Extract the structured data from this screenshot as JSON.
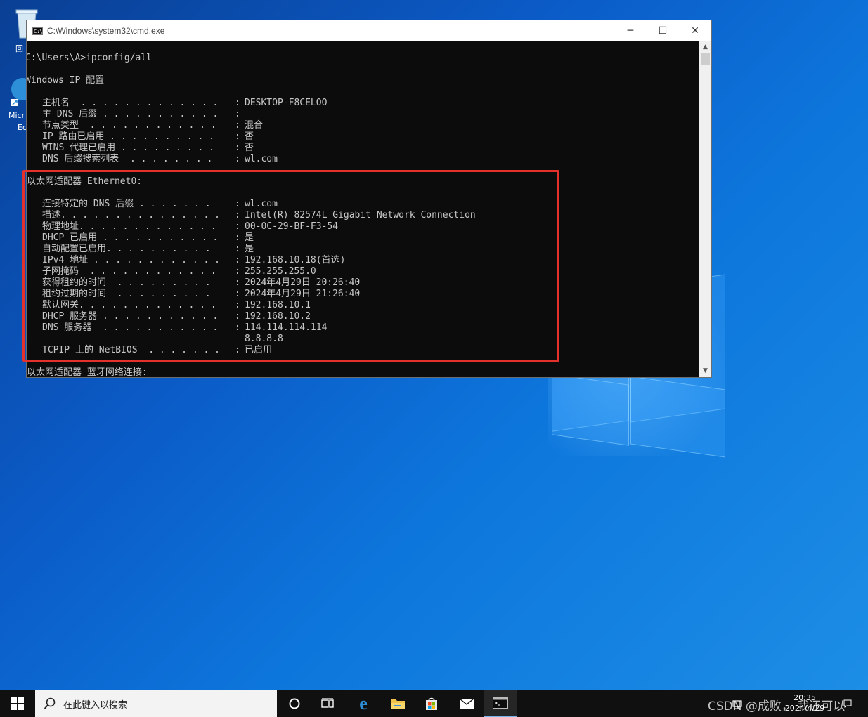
{
  "window": {
    "title": "C:\\Windows\\system32\\cmd.exe",
    "icon_label": "C:\\",
    "minimize_glyph": "─",
    "maximize_glyph": "☐",
    "close_glyph": "✕"
  },
  "console": {
    "command": "C:\\Users\\A>ipconfig/all",
    "header": "Windows IP 配置",
    "global_rows": [
      {
        "key": "主机名  . . . . . . . . . . . . .",
        "value": "DESKTOP-F8CELOO"
      },
      {
        "key": "主 DNS 后缀 . . . . . . . . . . .",
        "value": ""
      },
      {
        "key": "节点类型  . . . . . . . . . . . .",
        "value": "混合"
      },
      {
        "key": "IP 路由已启用 . . . . . . . . . .",
        "value": "否"
      },
      {
        "key": "WINS 代理已启用 . . . . . . . . .",
        "value": "否"
      },
      {
        "key": "DNS 后缀搜索列表  . . . . . . . .",
        "value": "wl.com"
      }
    ],
    "adapter_header": "以太网适配器 Ethernet0:",
    "adapter_rows": [
      {
        "key": "连接特定的 DNS 后缀 . . . . . . .",
        "value": "wl.com"
      },
      {
        "key": "描述. . . . . . . . . . . . . . .",
        "value": "Intel(R) 82574L Gigabit Network Connection"
      },
      {
        "key": "物理地址. . . . . . . . . . . . .",
        "value": "00-0C-29-BF-F3-54"
      },
      {
        "key": "DHCP 已启用 . . . . . . . . . . .",
        "value": "是"
      },
      {
        "key": "自动配置已启用. . . . . . . . . .",
        "value": "是"
      },
      {
        "key": "IPv4 地址 . . . . . . . . . . . .",
        "value": "192.168.10.18(首选)"
      },
      {
        "key": "子网掩码  . . . . . . . . . . . .",
        "value": "255.255.255.0"
      },
      {
        "key": "获得租约的时间  . . . . . . . . .",
        "value": "2024年4月29日 20:26:40"
      },
      {
        "key": "租约过期的时间  . . . . . . . . .",
        "value": "2024年4月29日 21:26:40"
      },
      {
        "key": "默认网关. . . . . . . . . . . . .",
        "value": "192.168.10.1"
      },
      {
        "key": "DHCP 服务器 . . . . . . . . . . .",
        "value": "192.168.10.2"
      },
      {
        "key": "DNS 服务器  . . . . . . . . . . .",
        "value": "114.114.114.114"
      },
      {
        "key": "",
        "value": "8.8.8.8"
      },
      {
        "key": "TCPIP 上的 NetBIOS  . . . . . . .",
        "value": "已启用"
      }
    ],
    "next_adapter_header": "以太网适配器 蓝牙网络连接:"
  },
  "desktop": {
    "recycle_label": "回",
    "edge_label_1": "Micr",
    "edge_label_2": "Ec"
  },
  "taskbar": {
    "search_placeholder": "在此键入以搜索",
    "clock_time": "20:35",
    "clock_date": "2024/4/29",
    "watermark": "CSDN @成败， 我还可以"
  },
  "colors": {
    "highlight": "#e5312b",
    "console_bg": "#0c0c0c",
    "console_fg": "#c8c8c8"
  }
}
